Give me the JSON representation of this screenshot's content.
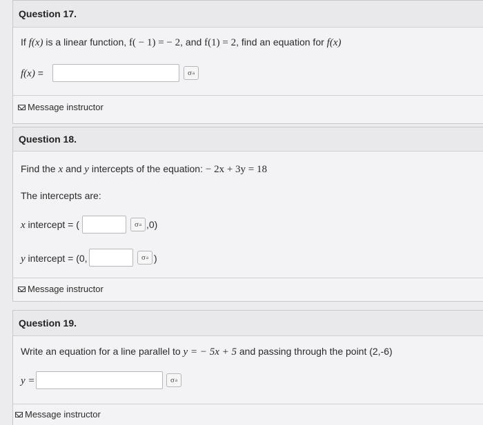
{
  "q17": {
    "title": "Question 17.",
    "prompt_prefix": "If ",
    "prompt_fx": "f(x)",
    "prompt_mid1": " is a linear function, ",
    "prompt_eq1": "f( − 1) =  − 2",
    "prompt_mid2": ", and ",
    "prompt_eq2": "f(1) = 2",
    "prompt_mid3": ", find an equation for ",
    "prompt_fx2": "f(x)",
    "answer_label_math": "f(x)",
    "answer_label_eq": " =",
    "answer_value": "",
    "formula_icon": "σ",
    "message": "Message instructor"
  },
  "q18": {
    "title": "Question 18.",
    "prompt_prefix": "Find the ",
    "prompt_x": "x",
    "prompt_and": " and ",
    "prompt_y": "y",
    "prompt_suffix": " intercepts of the equation: ",
    "prompt_eq": "− 2x + 3y = 18",
    "subprompt": "The intercepts are:",
    "x_label_var": "x",
    "x_label_text": " intercept = (",
    "x_suffix": ",0)",
    "y_label_var": "y",
    "y_label_text": " intercept = (0,",
    "y_suffix": ")",
    "formula_icon": "σ",
    "message": "Message instructor"
  },
  "q19": {
    "title": "Question 19.",
    "prompt_prefix": "Write an equation for a line parallel to ",
    "prompt_eq": "y =  − 5x + 5",
    "prompt_suffix": " and passing through the point (2,-6)",
    "answer_label": "y =",
    "formula_icon": "σ",
    "message": "Message instructor"
  }
}
